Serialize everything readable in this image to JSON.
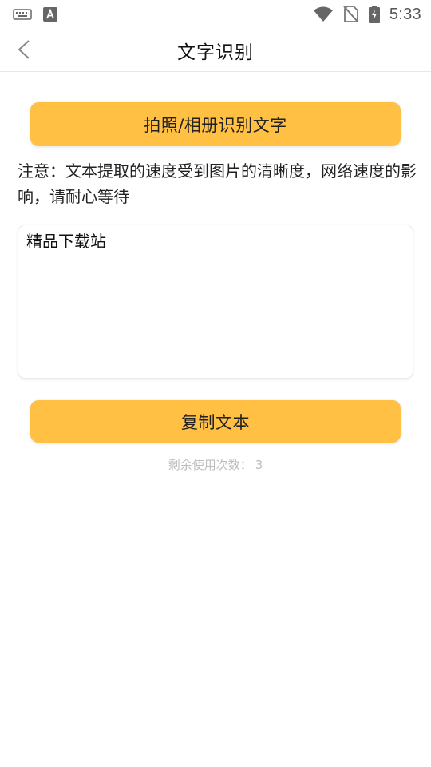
{
  "status_bar": {
    "time": "5:33",
    "icons": [
      "keyboard-icon",
      "font-a-icon",
      "wifi-icon",
      "no-sim-icon",
      "battery-charging-icon"
    ]
  },
  "app_bar": {
    "title": "文字识别",
    "back_icon": "chevron-left-icon"
  },
  "actions": {
    "capture_label": "拍照/相册识别文字",
    "copy_label": "复制文本"
  },
  "notice": "注意：文本提取的速度受到图片的清晰度，网络速度的影响，请耐心等待",
  "result_text": "精品下载站",
  "usage": {
    "label": "剩余使用次数：",
    "count": "3"
  },
  "colors": {
    "accent": "#ffc043",
    "muted_text": "#bdbdbd"
  }
}
